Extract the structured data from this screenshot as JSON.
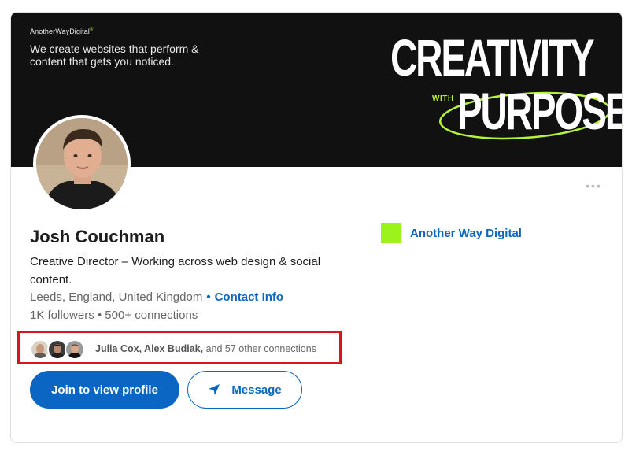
{
  "banner": {
    "brand": "AnotherWayDigital",
    "brand_mark": "®",
    "tagline": "We create websites that perform & content that gets you noticed.",
    "headline_top": "CREATIVITY",
    "headline_with": "WITH",
    "headline_bottom": "PURPOSE",
    "accent_color": "#b6f23a"
  },
  "profile": {
    "name": "Josh Couchman",
    "headline": "Creative Director – Working across web design & social content.",
    "location": "Leeds, England, United Kingdom",
    "separator": "•",
    "contact_info_label": "Contact Info",
    "stats": "1K followers • 500+ connections"
  },
  "mutual_connections": {
    "names": "Julia Cox, Alex Budiak,",
    "rest": " and 57 other connections"
  },
  "actions": {
    "join_label": "Join to view profile",
    "message_label": "Message",
    "more_icon": "more-horizontal-icon"
  },
  "company": {
    "name": "Another Way Digital",
    "logo_color": "#9cf21b"
  },
  "colors": {
    "primary": "#0a66c2",
    "highlight_box": "#e1121d",
    "banner_bg": "#111111"
  }
}
